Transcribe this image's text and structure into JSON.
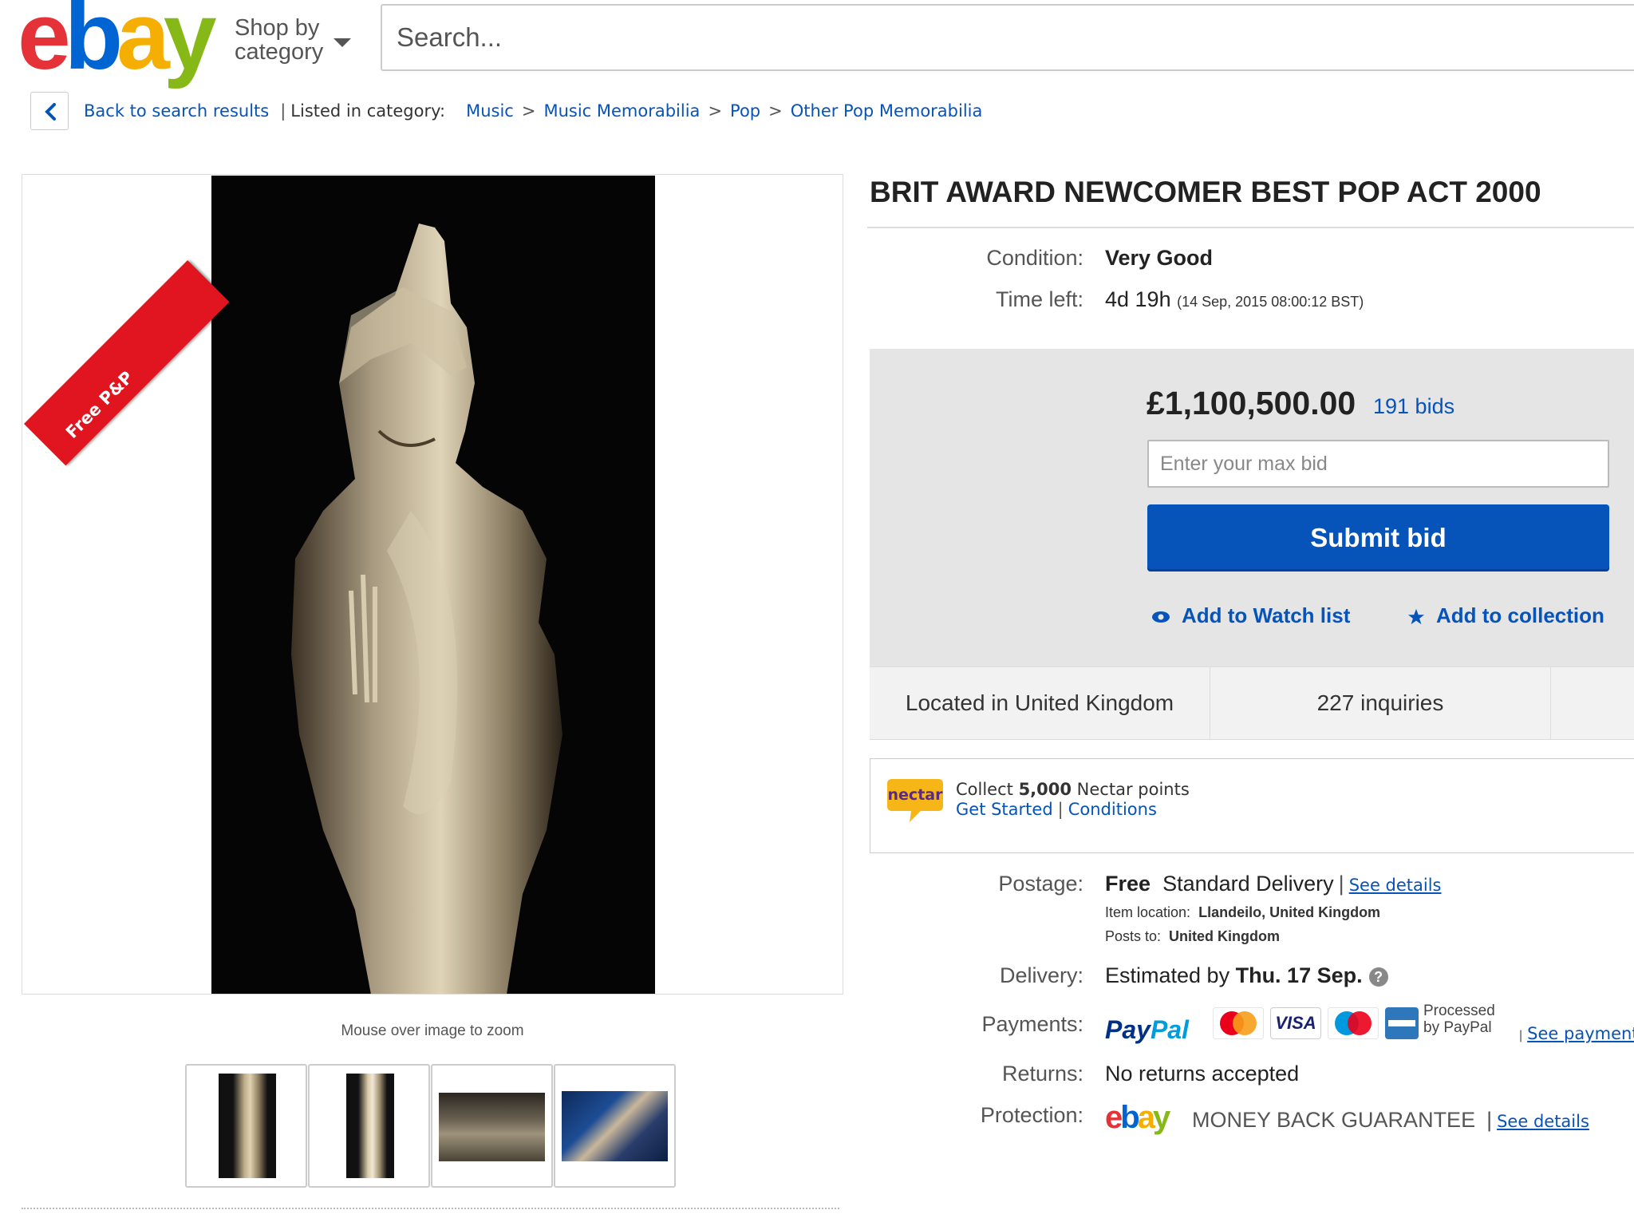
{
  "header": {
    "logo_letters": [
      "e",
      "b",
      "a",
      "y"
    ],
    "logo_colors": [
      "#e53238",
      "#0064d2",
      "#f5af02",
      "#86b817"
    ],
    "shop_by_line1": "Shop by",
    "shop_by_line2": "category",
    "search_placeholder": "Search..."
  },
  "breadcrumb": {
    "back_label": "Back to search results",
    "listed_label": "Listed in category:",
    "items": [
      "Music",
      "Music Memorabilia",
      "Pop",
      "Other Pop Memorabilia"
    ],
    "separator": ">"
  },
  "gallery": {
    "ribbon_text": "Free P&P",
    "ribbon_color": "#e0151f",
    "zoom_hint": "Mouse over image to zoom",
    "thumbnail_count": 4
  },
  "item": {
    "title": "BRIT AWARD NEWCOMER BEST POP ACT 2000",
    "condition_label": "Condition:",
    "condition_value": "Very Good",
    "time_left_label": "Time left:",
    "time_left_value": "4d 19h",
    "time_left_detail": "(14 Sep, 2015   08:00:12 BST)"
  },
  "bid": {
    "price": "£1,100,500.00",
    "bids": "191 bids",
    "input_placeholder": "Enter your max bid",
    "submit_label": "Submit bid",
    "watch_label": "Add to Watch list",
    "collection_label": "Add to collection",
    "accent_color": "#0654ba"
  },
  "stats": {
    "location": "Located in United Kingdom",
    "inquiries": "227 inquiries"
  },
  "nectar": {
    "logo_text": "nectar",
    "collect_prefix": "Collect ",
    "points": "5,000",
    "collect_suffix": " Nectar points",
    "get_started": "Get Started",
    "conditions": "Conditions"
  },
  "postage": {
    "label": "Postage:",
    "free": "Free",
    "service": "Standard Delivery",
    "see_details": "See details",
    "item_location_label": "Item location:",
    "item_location": "Llandeilo, United Kingdom",
    "posts_to_label": "Posts to:",
    "posts_to": "United Kingdom"
  },
  "delivery": {
    "label": "Delivery:",
    "prefix": "Estimated by ",
    "date": "Thu. 17 Sep.",
    "help_icon": "?"
  },
  "payments": {
    "label": "Payments:",
    "paypal_part1": "Pay",
    "paypal_part2": "Pal",
    "cards": [
      "MasterCard",
      "VISA",
      "Maestro",
      "American Express"
    ],
    "processed_line1": "Processed",
    "processed_line2": "by PayPal",
    "see_payments": "See payment"
  },
  "returns": {
    "label": "Returns:",
    "value": "No returns accepted"
  },
  "protection": {
    "label": "Protection:",
    "ebay_letters": [
      "e",
      "b",
      "a",
      "y"
    ],
    "guarantee": "MONEY BACK GUARANTEE",
    "see_details": "See details"
  }
}
